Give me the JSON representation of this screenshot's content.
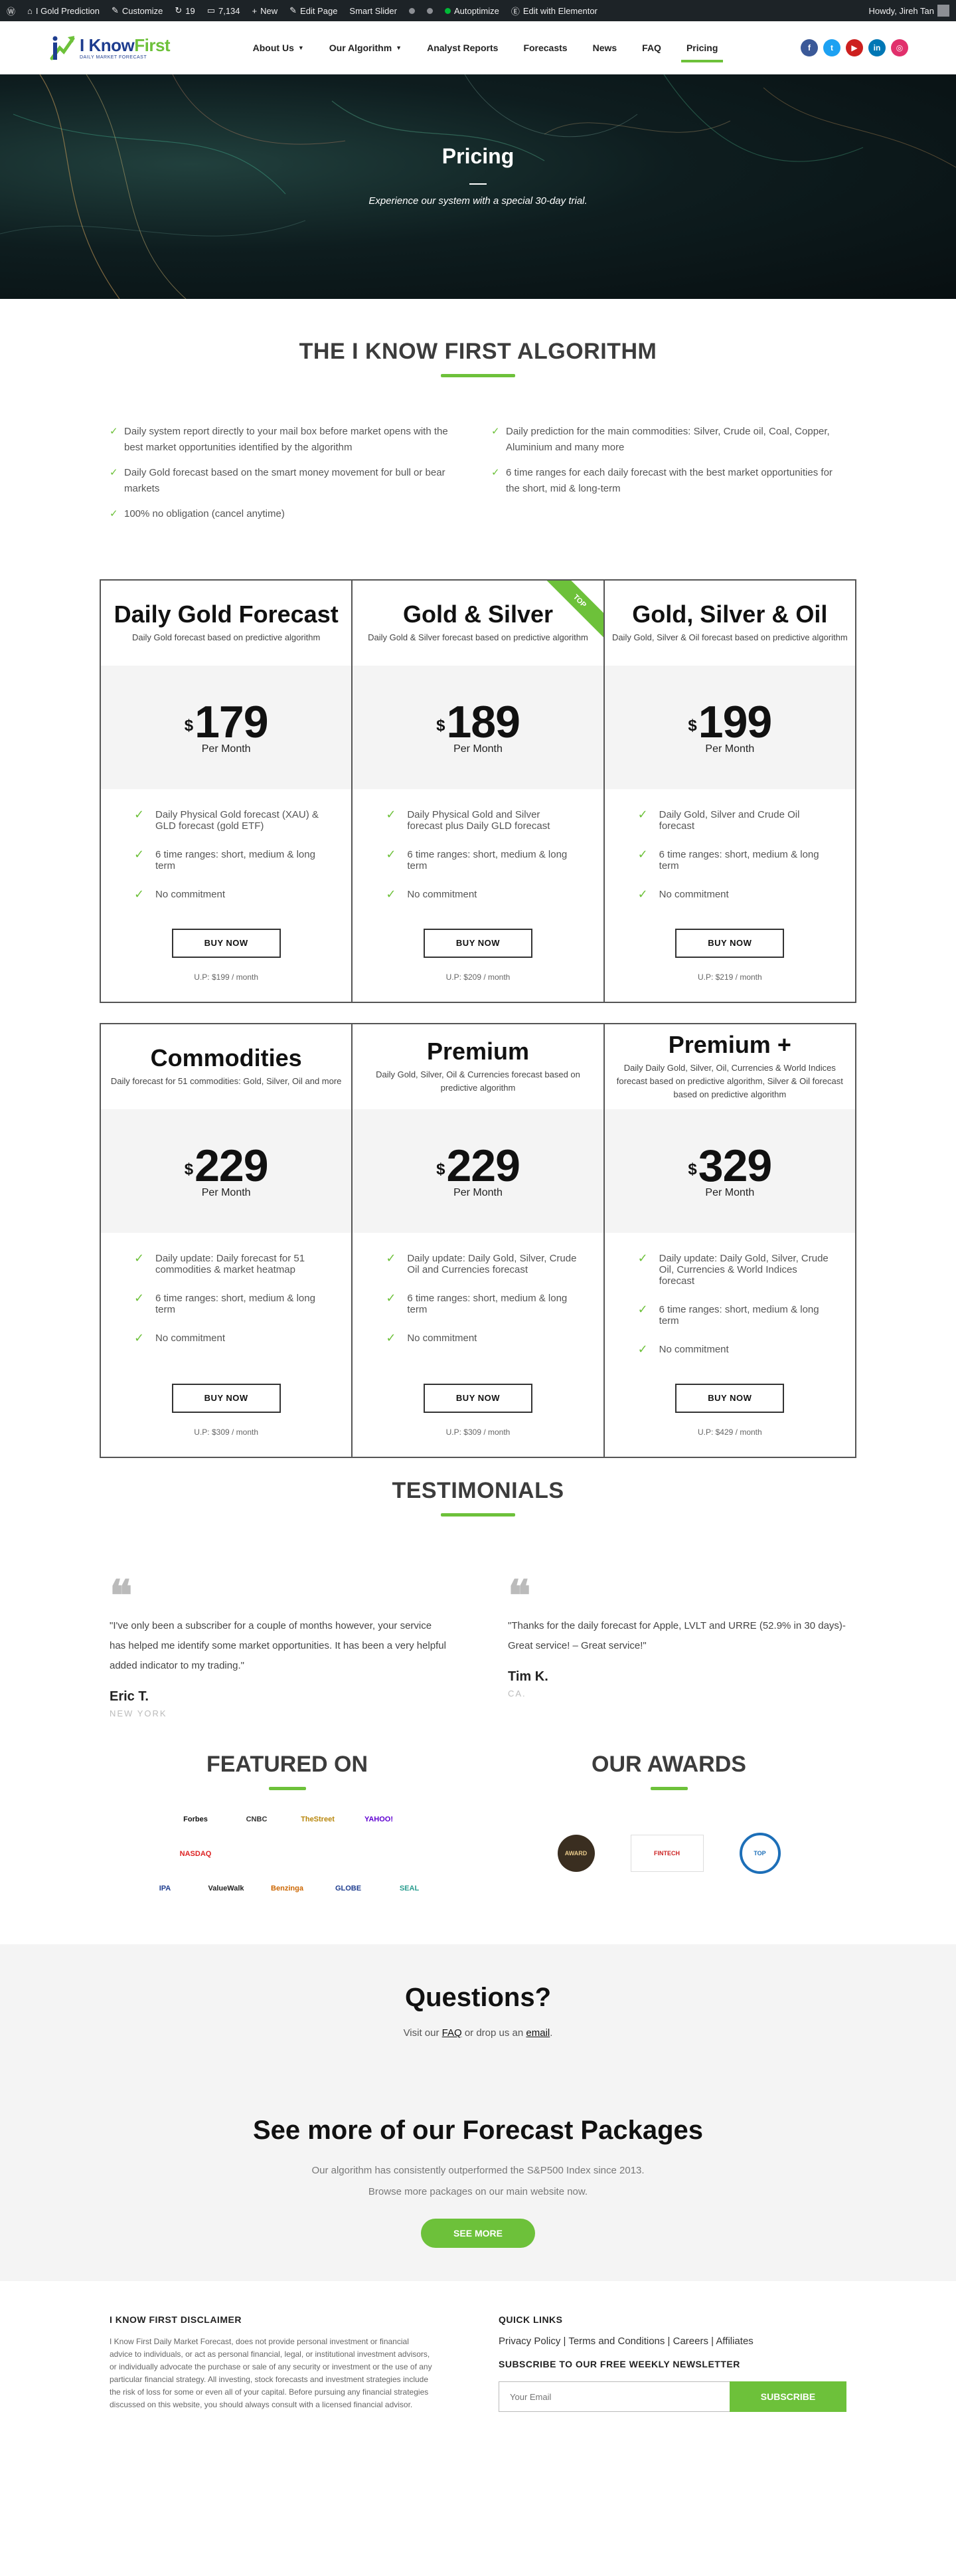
{
  "adminbar": {
    "site": "I Gold Prediction",
    "customize": "Customize",
    "updates": "19",
    "comments": "7,134",
    "new": "New",
    "edit_page": "Edit Page",
    "smart_slider": "Smart Slider",
    "autoptimize": "Autoptimize",
    "elementor": "Edit with Elementor",
    "howdy": "Howdy, Jireh Tan"
  },
  "header": {
    "logo_i_know": "I Know",
    "logo_first": "First",
    "logo_sub": "DAILY MARKET FORECAST",
    "nav": [
      {
        "label": "About Us",
        "dropdown": true
      },
      {
        "label": "Our Algorithm",
        "dropdown": true
      },
      {
        "label": "Analyst Reports"
      },
      {
        "label": "Forecasts"
      },
      {
        "label": "News"
      },
      {
        "label": "FAQ"
      },
      {
        "label": "Pricing",
        "active": true
      }
    ],
    "socials": [
      {
        "icon": "facebook-icon",
        "glyph": "f",
        "color": "#3b5998"
      },
      {
        "icon": "twitter-icon",
        "glyph": "t",
        "color": "#1da1f2"
      },
      {
        "icon": "youtube-icon",
        "glyph": "▶",
        "color": "#cd201f"
      },
      {
        "icon": "linkedin-icon",
        "glyph": "in",
        "color": "#0077b5"
      },
      {
        "icon": "instagram-icon",
        "glyph": "◎",
        "color": "#e1306c"
      }
    ]
  },
  "hero": {
    "title": "Pricing",
    "subtitle": "Experience our system with a special 30-day trial."
  },
  "algorithm": {
    "title": "THE I KNOW FIRST ALGORITHM",
    "left": [
      "Daily system report directly to your mail box before market opens with the best market opportunities identified by the algorithm",
      "Daily Gold forecast based on the smart money movement for bull or bear markets",
      "100% no obligation (cancel anytime)"
    ],
    "right": [
      "Daily prediction for the main commodities: Silver, Crude oil, Coal, Copper, Aluminium and many more",
      "6 time ranges for each daily forecast with the best market opportunities for the short, mid & long-term"
    ]
  },
  "plans": [
    {
      "title": "Daily Gold Forecast",
      "desc": "Daily Gold forecast based on predictive algorithm",
      "currency": "$",
      "price": "179",
      "per": "Per Month",
      "features": [
        "Daily Physical Gold forecast (XAU) & GLD forecast (gold ETF)",
        "6 time ranges: short, medium & long term",
        "No commitment"
      ],
      "button": "BUY NOW",
      "up": "U.P: $199 / month"
    },
    {
      "title": "Gold & Silver",
      "desc": "Daily Gold & Silver forecast based on predictive algorithm",
      "ribbon": "TOP",
      "currency": "$",
      "price": "189",
      "per": "Per Month",
      "features": [
        "Daily Physical Gold and Silver forecast plus Daily GLD forecast",
        "6 time ranges: short, medium & long term",
        "No commitment"
      ],
      "button": "BUY NOW",
      "up": "U.P: $209 / month"
    },
    {
      "title": "Gold, Silver & Oil",
      "desc": "Daily Gold, Silver & Oil forecast based on predictive algorithm",
      "currency": "$",
      "price": "199",
      "per": "Per Month",
      "features": [
        "Daily Gold, Silver and Crude Oil forecast",
        "6 time ranges: short, medium & long term",
        "No commitment"
      ],
      "button": "BUY NOW",
      "up": "U.P: $219 / month"
    },
    {
      "title": "Commodities",
      "desc": "Daily forecast for 51 commodities: Gold, Silver, Oil and more",
      "currency": "$",
      "price": "229",
      "per": "Per Month",
      "features": [
        "Daily update: Daily forecast for 51 commodities & market heatmap",
        "6 time ranges: short, medium & long term",
        "No commitment"
      ],
      "button": "BUY NOW",
      "up": "U.P: $309 / month"
    },
    {
      "title": "Premium",
      "desc": "Daily Gold, Silver, Oil & Currencies forecast based on predictive algorithm",
      "currency": "$",
      "price": "229",
      "per": "Per Month",
      "features": [
        "Daily update: Daily Gold, Silver, Crude Oil and Currencies forecast",
        "6 time ranges: short, medium & long term",
        "No commitment"
      ],
      "button": "BUY NOW",
      "up": "U.P: $309 / month"
    },
    {
      "title": "Premium +",
      "desc": "Daily Daily Gold, Silver, Oil, Currencies & World Indices forecast based on predictive algorithm, Silver & Oil forecast based on predictive algorithm",
      "currency": "$",
      "price": "329",
      "per": "Per Month",
      "features": [
        "Daily update: Daily Gold, Silver, Crude Oil, Currencies & World Indices forecast",
        "6 time ranges: short, medium & long term",
        "No commitment"
      ],
      "button": "BUY NOW",
      "up": "U.P: $429 / month"
    }
  ],
  "testimonials": {
    "title": "TESTIMONIALS",
    "items": [
      {
        "quote": "\"I've only been a subscriber for a couple of months however, your service has helped me identify some market opportunities. It has been a very helpful added indicator to my trading.\"",
        "name": "Eric T.",
        "location": "NEW YORK"
      },
      {
        "quote": "\"Thanks for the daily forecast for Apple, LVLT and URRE (52.9% in 30 days)-Great service! – Great service!\"",
        "name": "Tim K.",
        "location": "CA."
      }
    ]
  },
  "featured": {
    "title": "FEATURED ON",
    "logos_a": [
      {
        "name": "forbes-logo",
        "text": "Forbes",
        "color": "#111"
      },
      {
        "name": "cnbc-logo",
        "text": "CNBC",
        "color": "#333"
      },
      {
        "name": "the-street-logo",
        "text": "TheStreet",
        "color": "#b8860b"
      },
      {
        "name": "yahoo-logo",
        "text": "YAHOO!",
        "color": "#6001d2"
      },
      {
        "name": "nasdaq-logo",
        "text": "NASDAQ",
        "color": "#d22"
      }
    ],
    "logos_b": [
      {
        "name": "ipa-logo",
        "text": "IPA",
        "color": "#1e3d8f"
      },
      {
        "name": "valuewalk-logo",
        "text": "ValueWalk",
        "color": "#222"
      },
      {
        "name": "benzinga-logo",
        "text": "Benzinga",
        "color": "#c60"
      },
      {
        "name": "globe-logo",
        "text": "GLOBE",
        "color": "#1e3d8f"
      },
      {
        "name": "seal-logo",
        "text": "SEAL",
        "color": "#2a9d8f"
      }
    ]
  },
  "awards": {
    "title": "OUR AWARDS",
    "items": [
      {
        "name": "award-badge-1",
        "text": "AWARD",
        "color": "#3a2e20"
      },
      {
        "name": "award-badge-2",
        "text": "FINTECH",
        "color": "#c22"
      },
      {
        "name": "award-badge-3",
        "text": "TOP",
        "color": "#1d6fb8"
      }
    ]
  },
  "questions": {
    "title": "Questions?",
    "prefix": "Visit our ",
    "faq": "FAQ",
    "middle": " or drop us an ",
    "email": "email",
    "suffix": "."
  },
  "more": {
    "title": "See more of our Forecast Packages",
    "line1": "Our algorithm has consistently outperformed the S&P500 Index since 2013.",
    "line2": "Browse more packages on our main website now.",
    "button": "SEE MORE"
  },
  "footer": {
    "disclaimer_title": "I KNOW FIRST DISCLAIMER",
    "disclaimer": "I Know First Daily Market Forecast, does not provide personal investment or financial advice to individuals, or act as personal financial, legal, or institutional investment advisors, or individually advocate the purchase or sale of any security or investment or the use of any particular financial strategy. All investing, stock forecasts and investment strategies include the risk of loss for some or even all of your capital. Before pursuing any financial strategies discussed on this website, you should always consult with a licensed financial advisor.",
    "quick_title": "QUICK LINKS",
    "links": "Privacy Policy | Terms and Conditions | Careers | Affiliates",
    "newsletter_title": "SUBSCRIBE TO OUR FREE WEEKLY NEWSLETTER",
    "email_placeholder": "Your Email",
    "subscribe": "SUBSCRIBE"
  }
}
